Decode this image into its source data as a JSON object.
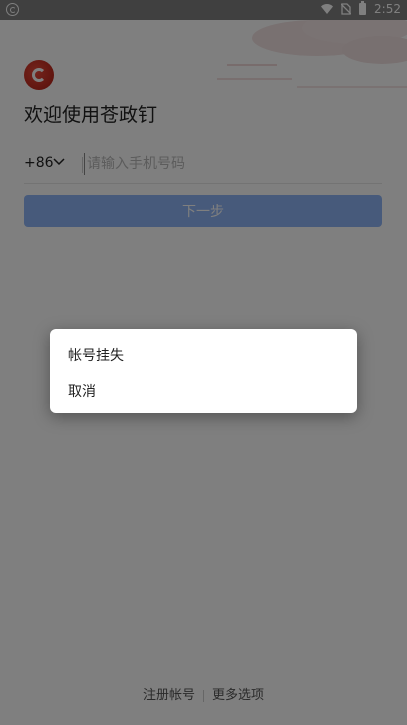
{
  "status_bar": {
    "time": "2:52",
    "icons": [
      "app-notification-icon",
      "wifi-icon",
      "no-sim-icon",
      "battery-icon"
    ]
  },
  "login": {
    "logo_icon": "app-logo-icon",
    "welcome_text": "欢迎使用苍政钉",
    "country_code": "+86",
    "phone_placeholder": "请输入手机号码",
    "next_button_label": "下一步",
    "next_button_color": "#8fb5f6"
  },
  "footer": {
    "register_label": "注册帐号",
    "more_options_label": "更多选项"
  },
  "dialog": {
    "items": [
      {
        "label": "帐号挂失"
      },
      {
        "label": "取消"
      }
    ]
  },
  "colors": {
    "scrim": "rgba(0,0,0,0.5)",
    "brand_red": "#c8281c"
  }
}
